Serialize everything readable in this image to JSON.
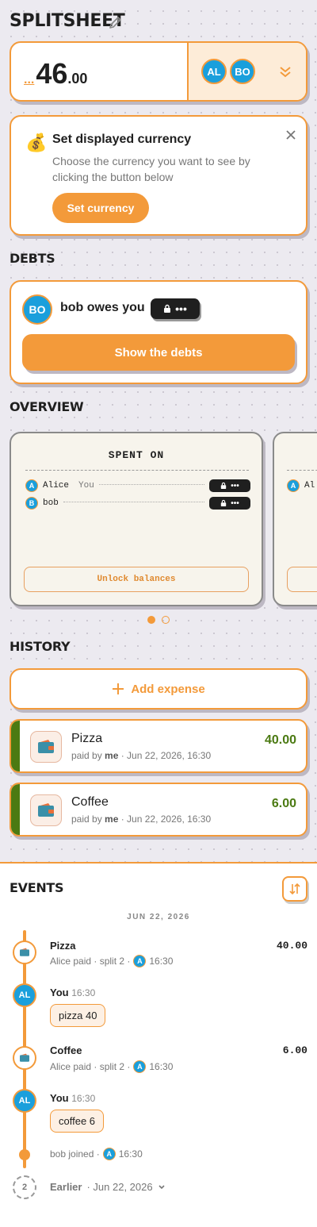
{
  "header": {
    "title": "SPLITSHEET"
  },
  "total": {
    "prefix": "...",
    "whole": "46",
    "cents": ".00",
    "members": [
      "AL",
      "BO"
    ]
  },
  "currency_banner": {
    "title": "Set displayed currency",
    "description": "Choose the currency you want to see by clicking the button below",
    "button": "Set currency"
  },
  "debts": {
    "heading": "DEBTS",
    "avatar": "BO",
    "text": "bob owes you",
    "hidden_amount": "•••",
    "button": "Show the debts"
  },
  "overview": {
    "heading": "OVERVIEW",
    "card_title": "SPENT ON",
    "rows": [
      {
        "initial": "A",
        "name": "Alice",
        "tag": "You",
        "value": "•••"
      },
      {
        "initial": "B",
        "name": "bob",
        "tag": "",
        "value": "•••"
      }
    ],
    "unlock": "Unlock balances",
    "peek_row": {
      "initial": "A",
      "name": "Al"
    }
  },
  "history": {
    "heading": "HISTORY",
    "add": "Add expense",
    "items": [
      {
        "title": "Pizza",
        "paid_by": "paid by",
        "payer": "me",
        "date": " · Jun 22, 2026, 16:30",
        "amount": "40.00"
      },
      {
        "title": "Coffee",
        "paid_by": "paid by",
        "payer": "me",
        "date": " · Jun 22, 2026, 16:30",
        "amount": "6.00"
      }
    ]
  },
  "events": {
    "heading": "EVENTS",
    "date": "JUN 22, 2026",
    "items": [
      {
        "title": "Pizza",
        "sub": "Alice paid · split 2 ·",
        "initial": "A",
        "time": "16:30",
        "amount": "40.00"
      },
      {
        "who": "You",
        "avatar": "AL",
        "time": "16:30",
        "message": "pizza 40"
      },
      {
        "title": "Coffee",
        "sub": "Alice paid · split 2 ·",
        "initial": "A",
        "time": "16:30",
        "amount": "6.00"
      },
      {
        "who": "You",
        "avatar": "AL",
        "time": "16:30",
        "message": "coffee 6"
      },
      {
        "sub": "bob joined ·",
        "initial": "A",
        "time": "16:30"
      }
    ],
    "earlier": {
      "count": "2",
      "label": "Earlier",
      "date": "· Jun 22, 2026"
    }
  },
  "colors": {
    "accent": "#f39a3a",
    "avatar": "#1a9fdc",
    "positive": "#4b7a12"
  }
}
